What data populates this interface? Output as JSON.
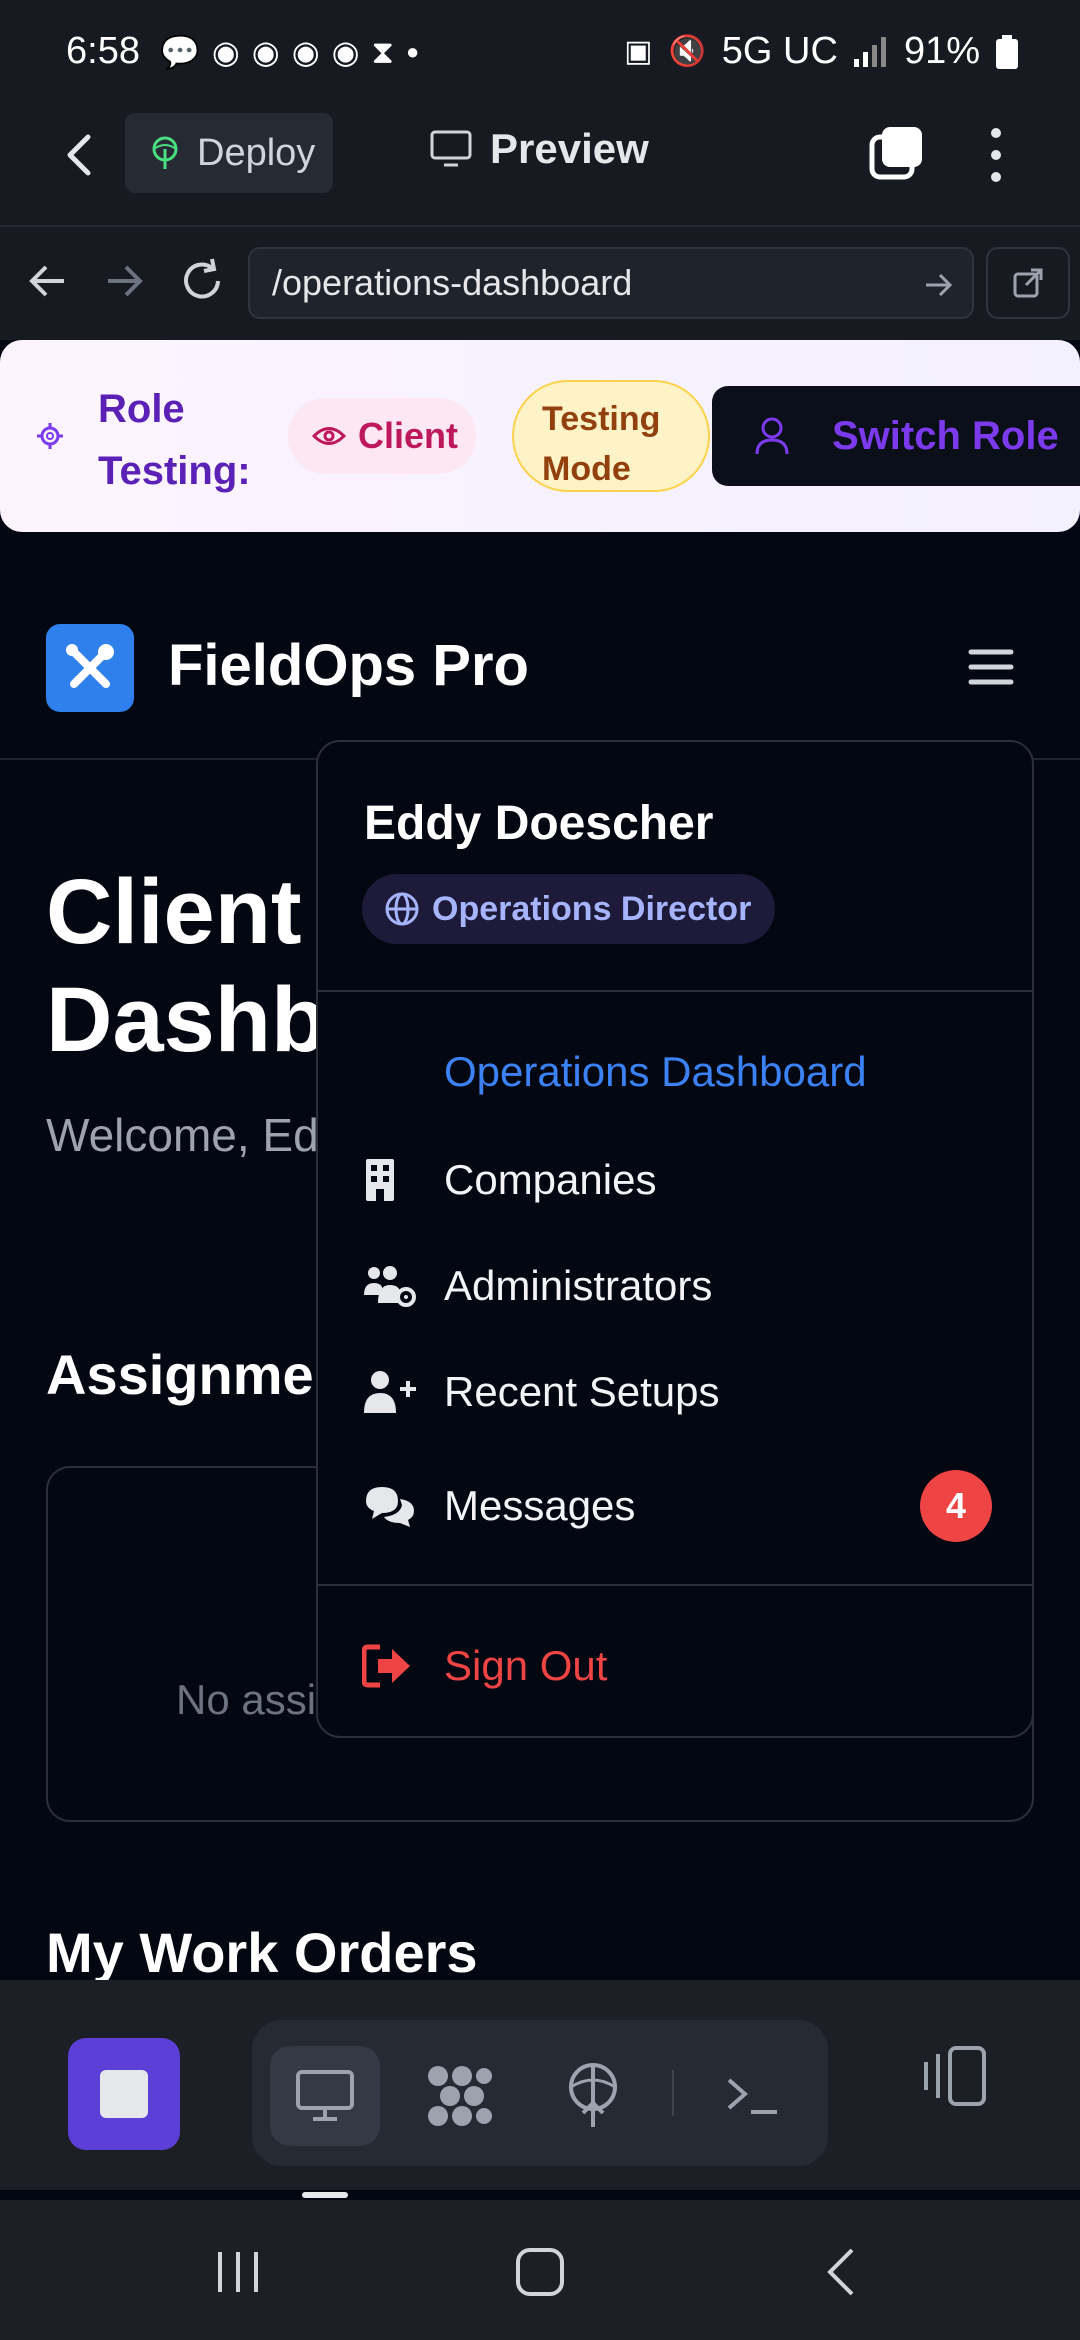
{
  "status_bar": {
    "time": "6:58",
    "network": "5G UC",
    "battery": "91%"
  },
  "app_bar": {
    "deploy_label": "Deploy",
    "preview_label": "Preview"
  },
  "url_bar": {
    "url": "/operations-dashboard"
  },
  "role_banner": {
    "label": "Role Testing:",
    "role_chip": "Client",
    "testing_chip": "Testing Mode",
    "switch_label": "Switch Role"
  },
  "header": {
    "brand": "FieldOps Pro"
  },
  "page": {
    "title": "Client Dashboard",
    "welcome": "Welcome, Eddy Doescher",
    "assignments_heading": "Assignments",
    "assignments_empty": "No assignments",
    "work_orders_heading": "My Work Orders"
  },
  "menu": {
    "user_name": "Eddy Doescher",
    "user_role": "Operations Director",
    "items": [
      {
        "label": "Operations Dashboard",
        "icon": "none",
        "active": true
      },
      {
        "label": "Companies",
        "icon": "building-icon"
      },
      {
        "label": "Administrators",
        "icon": "users-cog-icon"
      },
      {
        "label": "Recent Setups",
        "icon": "user-plus-icon"
      },
      {
        "label": "Messages",
        "icon": "comments-icon",
        "badge": "4"
      }
    ],
    "sign_out": "Sign Out"
  },
  "colors": {
    "accent": "#3b82f6",
    "brand_logo": "#2f80ed",
    "danger": "#ef4444",
    "role_purple": "#5b21b6",
    "stop_button": "#5b3fd6"
  }
}
